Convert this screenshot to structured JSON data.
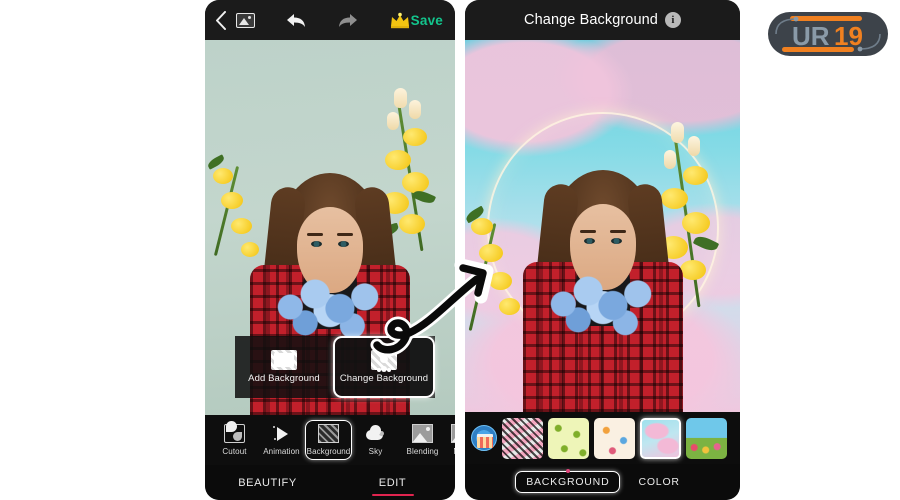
{
  "left_phone": {
    "topbar": {
      "back_icon": "chevron-left-icon",
      "gallery_icon": "image-icon",
      "undo_icon": "undo-arrow-icon",
      "redo_icon": "redo-arrow-icon",
      "premium_icon": "crown-icon",
      "save_label": "Save",
      "save_color": "#13c48c"
    },
    "popup": {
      "items": [
        {
          "label": "Add Background",
          "icon": "checker-blank-icon",
          "selected": false
        },
        {
          "label": "Change Background",
          "icon": "checker-person-icon",
          "selected": true
        }
      ]
    },
    "toolbar": {
      "items": [
        {
          "label": "Cutout",
          "icon": "cutout-icon",
          "selected": false
        },
        {
          "label": "Animation",
          "icon": "play-icon",
          "selected": false
        },
        {
          "label": "Background",
          "icon": "hatch-pattern-icon",
          "selected": true
        },
        {
          "label": "Sky",
          "icon": "cloud-icon",
          "selected": false
        },
        {
          "label": "Blending",
          "icon": "blend-image-icon",
          "selected": false
        },
        {
          "label": "Ma",
          "icon": "partial-icon",
          "selected": false
        }
      ]
    },
    "tabs": [
      {
        "label": "BEAUTIFY",
        "active": false
      },
      {
        "label": "EDIT",
        "active": true
      }
    ],
    "tab_underline_color": "#e0244f",
    "photo_background_color": "#bdd2c9"
  },
  "right_phone": {
    "topbar": {
      "title": "Change Background",
      "info_icon": "info-icon",
      "info_glyph": "i"
    },
    "thumbnails": {
      "store_icon": "store-icon",
      "items": [
        {
          "name": "pink-leaf-pattern",
          "selected": false
        },
        {
          "name": "avocado-pattern",
          "selected": false
        },
        {
          "name": "love-doodle-pattern",
          "selected": false
        },
        {
          "name": "pink-cloud-sky",
          "selected": true
        },
        {
          "name": "flower-field-sky",
          "selected": false
        }
      ]
    },
    "tabs": [
      {
        "label": "BACKGROUND",
        "selected": true
      },
      {
        "label": "COLOR",
        "selected": false
      }
    ],
    "tab_dot_color": "#e0447a"
  },
  "arrow": {
    "name": "curved-arrow",
    "direction": "left-to-right"
  },
  "logo": {
    "name": "ur19-logo",
    "text_left": "UR",
    "text_right": "19",
    "color_accent": "#f08020",
    "color_text": "#8a9aa8",
    "color_body": "#3d434a"
  }
}
